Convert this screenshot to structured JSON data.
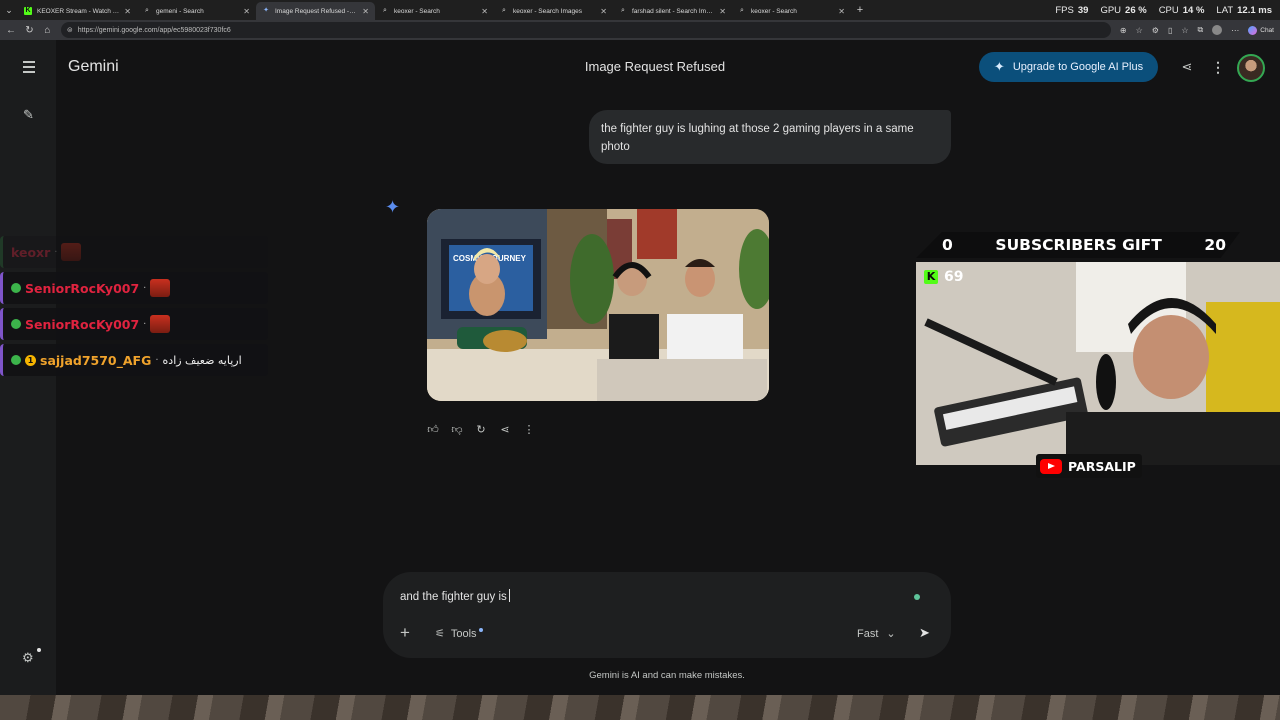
{
  "browser": {
    "tabs": [
      {
        "title": "KEOXER Stream - Watch Live on Kick",
        "icon": "kick-icon",
        "active": false
      },
      {
        "title": "gemeni - Search",
        "icon": "search-icon",
        "active": false
      },
      {
        "title": "Image Request Refused - Google Gemini",
        "icon": "gemini-icon",
        "active": true
      },
      {
        "title": "keoxer - Search",
        "icon": "search-icon",
        "active": false
      },
      {
        "title": "keoxer - Search Images",
        "icon": "search-icon",
        "active": false
      },
      {
        "title": "farshad silent - Search Images",
        "icon": "search-icon",
        "active": false
      },
      {
        "title": "keoxer - Search",
        "icon": "search-icon",
        "active": false
      }
    ],
    "url": "https://gemini.google.com/app/ec5980023f730fc6",
    "chat_label": "Chat"
  },
  "perf": {
    "fps_label": "FPS",
    "fps": "39",
    "gpu_label": "GPU",
    "gpu": "26 %",
    "cpu_label": "CPU",
    "cpu": "14 %",
    "lat_label": "LAT",
    "lat": "12.1 ms"
  },
  "app": {
    "brand": "Gemini",
    "title": "Image Request Refused",
    "upgrade_label": "Upgrade to Google AI Plus",
    "user_message": "the fighter guy is lughing at those 2 gaming players in a same photo",
    "image_poster_text": "COSMIC JOURNEY",
    "composer_text": "and the fighter guy is",
    "tools_label": "Tools",
    "mode_label": "Fast",
    "disclaimer": "Gemini is AI and can make mistakes."
  },
  "overlay": {
    "chat": [
      {
        "name": "keoxr",
        "text": "",
        "faded": true
      },
      {
        "name": "SeniorRocKy007",
        "text": "",
        "faded": false
      },
      {
        "name": "SeniorRocKy007",
        "text": "",
        "faded": false
      },
      {
        "name": "sajjad7570_AFG",
        "text": "ارپایه ضعیف زاده",
        "faded": false
      }
    ],
    "sub_goal": {
      "left": "0",
      "label": "SUBSCRIBERS GIFT",
      "right": "20"
    },
    "viewers": "69",
    "channel": "PARSALIP"
  },
  "colors": {
    "accent": "#0b4f7b",
    "app_bg": "#131314",
    "kick_green": "#53fc18",
    "chat_name_red": "#e0233f",
    "chat_name_orange": "#f0a32c"
  }
}
